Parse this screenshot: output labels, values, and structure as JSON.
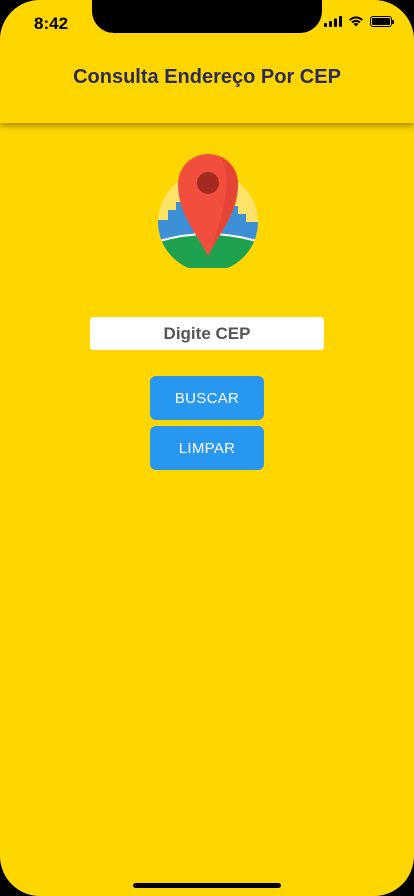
{
  "status_bar": {
    "time": "8:42"
  },
  "header": {
    "title": "Consulta Endereço Por CEP"
  },
  "logo": {
    "icon": "map-pin-city-icon"
  },
  "form": {
    "cep_placeholder": "Digite CEP",
    "cep_value": ""
  },
  "buttons": {
    "search_label": "BUSCAR",
    "clear_label": "LIMPAR"
  },
  "colors": {
    "background": "#FFD600",
    "title": "#2B2B5A",
    "button": "#2897F0",
    "pin": "#F24E3E",
    "buildings": "#3D8FD6",
    "ground": "#1FA24F"
  }
}
